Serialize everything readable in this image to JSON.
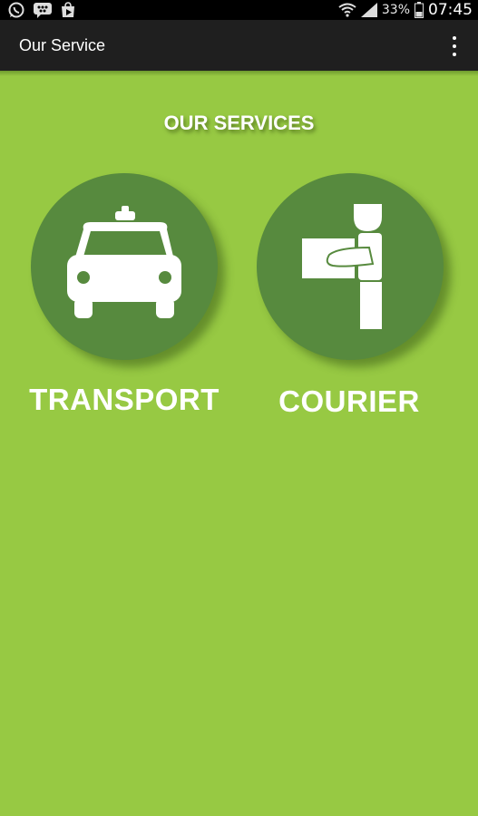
{
  "status_bar": {
    "battery": "33%",
    "time": "07:45",
    "icons": [
      "whatsapp-icon",
      "bbm-icon",
      "play-store-icon",
      "wifi-icon",
      "signal-icon",
      "battery-icon"
    ]
  },
  "action_bar": {
    "title": "Our Service",
    "overflow_icon": "overflow-menu-icon"
  },
  "main": {
    "heading": "OUR SERVICES",
    "services": [
      {
        "label": "TRANSPORT",
        "icon": "taxi-icon"
      },
      {
        "label": "COURIER",
        "icon": "courier-icon"
      }
    ]
  },
  "colors": {
    "background": "#97c943",
    "circle": "#578a3e",
    "action_bar": "#1f1f1f",
    "status_bar": "#000000"
  }
}
